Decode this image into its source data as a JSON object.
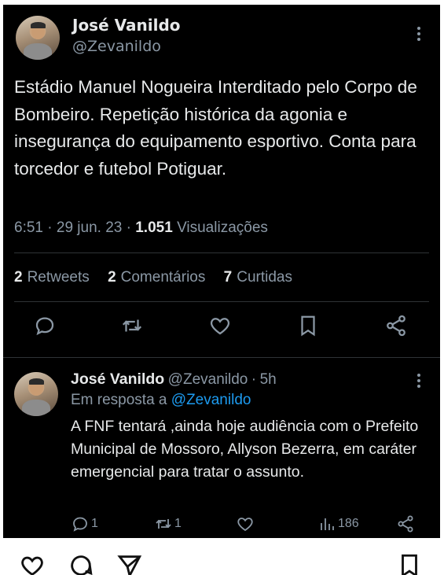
{
  "main_tweet": {
    "author_name": "José Vanildo",
    "author_handle": "@Zevanildo",
    "text": "Estádio Manuel Nogueira Interditado pelo Corpo de Bombeiro. Repetição histórica da agonia e insegurança do equipamento esportivo. Conta para torcedor e futebol Potiguar.",
    "time": "6:51",
    "date": "29 jun. 23",
    "views_count": "1.051",
    "views_label": "Visualizações",
    "retweets_count": "2",
    "retweets_label": "Retweets",
    "comments_count": "2",
    "comments_label": "Comentários",
    "likes_count": "7",
    "likes_label": "Curtidas",
    "action_icons": [
      "reply-icon",
      "retweet-icon",
      "heart-icon",
      "bookmark-icon",
      "share-icon"
    ]
  },
  "reply_tweet": {
    "author_name": "José Vanildo",
    "author_handle": "@Zevanildo",
    "time_ago": "5h",
    "reply_prefix": "Em resposta a",
    "reply_mention": "@Zevanildo",
    "text": "A FNF tentará ,ainda hoje audiência com o Prefeito Municipal  de Mossoro, Allyson Bezerra, em caráter emergencial para tratar o assunto.",
    "reply_count": "1",
    "retweet_count": "1",
    "views_count": "186"
  },
  "bottom_bar_icons": [
    "heart-icon",
    "comment-icon",
    "send-icon",
    "bookmark-icon"
  ],
  "colors": {
    "background": "#000000",
    "text_primary": "#e7e9ea",
    "text_secondary": "#8b98a5",
    "link": "#1d9bf0",
    "divider": "#2f3336"
  }
}
